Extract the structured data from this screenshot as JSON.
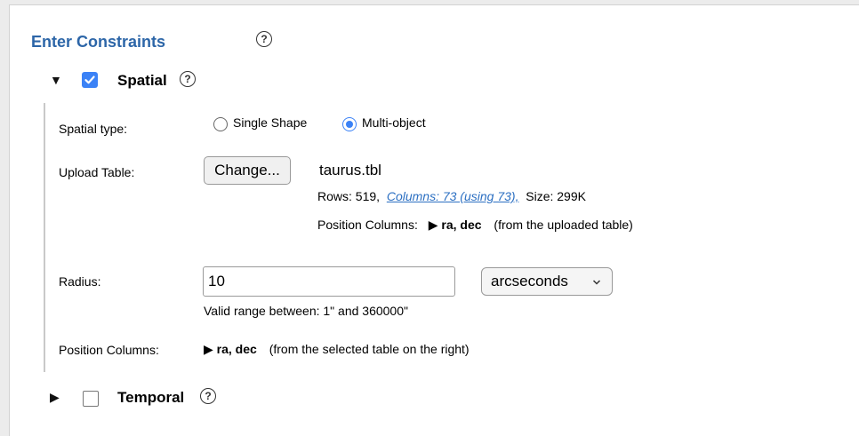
{
  "constraints": {
    "title": "Enter Constraints",
    "help_icon": "?"
  },
  "spatial": {
    "label": "Spatial",
    "checked": true,
    "help_icon": "?",
    "type_label": "Spatial type:",
    "option_single": "Single Shape",
    "option_multi": "Multi-object",
    "selected_option": "Multi-object",
    "upload_label": "Upload Table:",
    "change_button": "Change...",
    "file_name": "taurus.tbl",
    "rows_text": "Rows: 519,",
    "columns_link": "Columns: 73 (using 73),",
    "size_text": "Size: 299K",
    "uploaded_pos_label": "Position Columns:",
    "uploaded_pos_value": "ra, dec",
    "uploaded_pos_note": "(from the uploaded table)",
    "radius_label": "Radius:",
    "radius_value": "10",
    "radius_unit": "arcseconds",
    "radius_hint": "Valid range between: 1\" and 360000\"",
    "pos_label": "Position Columns:",
    "pos_value": "ra, dec",
    "pos_note": "(from the selected table on the right)"
  },
  "temporal": {
    "label": "Temporal",
    "checked": false,
    "help_icon": "?"
  },
  "colors": {
    "title_blue": "#2d66a8",
    "accent_blue": "#3b82f6",
    "link_blue": "#2b6fc2"
  }
}
